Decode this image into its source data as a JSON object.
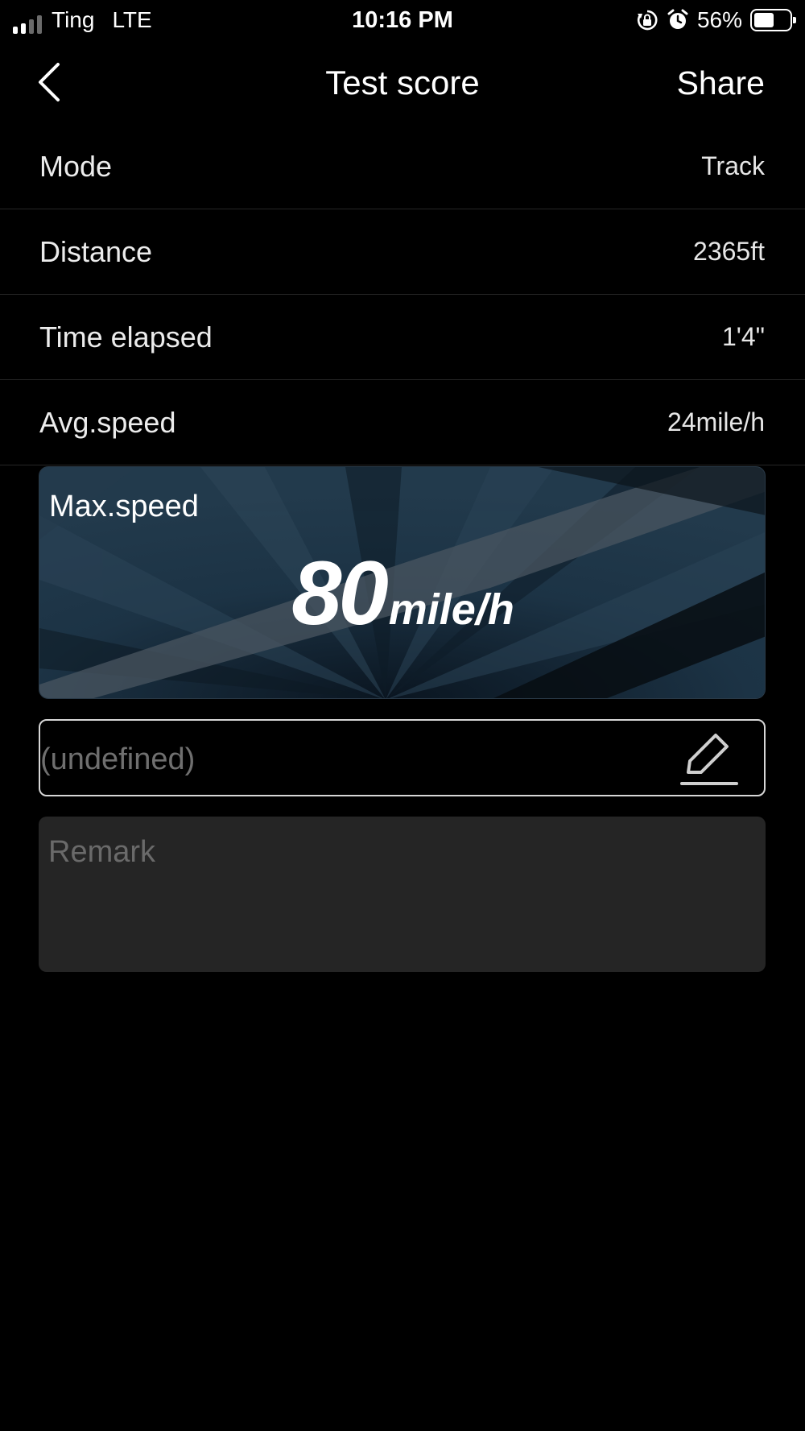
{
  "status_bar": {
    "carrier": "Ting",
    "network": "LTE",
    "time": "10:16 PM",
    "battery_percent": "56%",
    "battery_level": 0.56,
    "icons": [
      "signal-icon",
      "orientation-lock-icon",
      "alarm-icon",
      "battery-icon"
    ]
  },
  "nav": {
    "title": "Test score",
    "share_label": "Share",
    "back_icon": "chevron-left-icon"
  },
  "stats": [
    {
      "label": "Mode",
      "value": "Track"
    },
    {
      "label": "Distance",
      "value": "2365ft"
    },
    {
      "label": "Time elapsed",
      "value": "1'4\""
    },
    {
      "label": "Avg.speed",
      "value": "24mile/h"
    }
  ],
  "max_speed": {
    "label": "Max.speed",
    "value": "80",
    "unit": "mile/h"
  },
  "name_field": {
    "text": "(undefined)",
    "edit_icon": "pencil-icon"
  },
  "remark": {
    "placeholder": "Remark"
  },
  "colors": {
    "background": "#000000",
    "row_divider": "#262626",
    "remark_bg": "#252525",
    "placeholder": "#6f6f6f",
    "card_bg": "#0b1a26"
  }
}
